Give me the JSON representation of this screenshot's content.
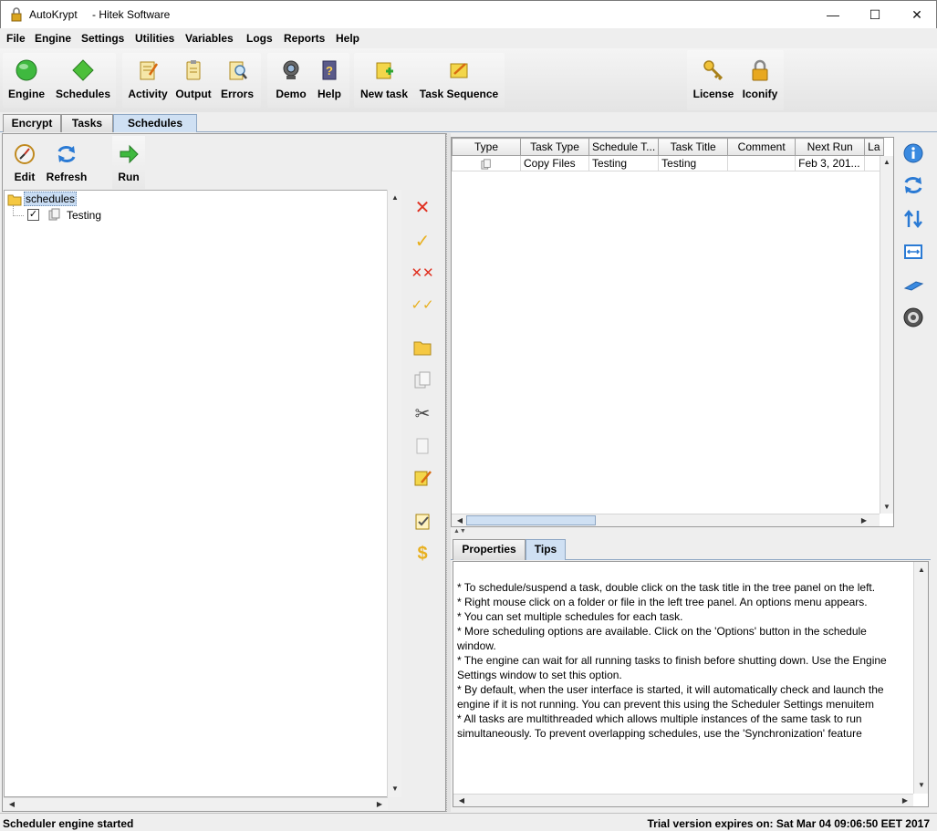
{
  "window": {
    "app_name": "AutoKrypt",
    "subtitle": "- Hitek Software",
    "minimize": "—",
    "maximize": "☐",
    "close": "✕"
  },
  "menu": [
    "File",
    "Engine",
    "Settings",
    "Utilities",
    "Variables",
    "Logs",
    "Reports",
    "Help"
  ],
  "toolbar": {
    "engine": "Engine",
    "schedules": "Schedules",
    "activity": "Activity",
    "output": "Output",
    "errors": "Errors",
    "demo": "Demo",
    "help": "Help",
    "new_task": "New task",
    "task_sequence": "Task Sequence",
    "license": "License",
    "iconify": "Iconify"
  },
  "tabs": [
    "Encrypt",
    "Tasks",
    "Schedules"
  ],
  "active_tab": "Schedules",
  "left": {
    "edit": "Edit",
    "refresh": "Refresh",
    "run": "Run",
    "tree_root": "schedules",
    "tree_item": "Testing",
    "tree_item_checked": true
  },
  "table": {
    "columns": [
      "Type",
      "Task Type",
      "Schedule T...",
      "Task Title",
      "Comment",
      "Next Run",
      "La"
    ],
    "rows": [
      [
        "",
        "Copy Files",
        "Testing",
        "Testing",
        "",
        "Feb 3, 201...",
        ""
      ]
    ]
  },
  "bottom_tabs": [
    "Properties",
    "Tips"
  ],
  "active_bottom_tab": "Tips",
  "tips": [
    "*  To schedule/suspend a task, double click on the task title in the tree panel on the left.",
    "*  Right mouse click on a folder or file in the left tree panel.  An options menu appears.",
    "*  You can set multiple schedules for each task.",
    "*  More scheduling options are available.  Click on the 'Options' button in the schedule",
    "window.",
    "*  The engine can wait for all running tasks to finish before shutting down.  Use the Engine",
    "Settings window to set this option.",
    "*  By default, when the user interface is started, it will automatically check and launch the",
    "engine if it is not running.  You can prevent this using the Scheduler Settings menuitem",
    "*  All tasks are multithreaded which allows multiple instances of the same task to run",
    "simultaneously.  To prevent overlapping schedules, use the 'Synchronization' feature"
  ],
  "status": {
    "left": "Scheduler engine started",
    "right": "Trial version expires on: Sat Mar 04 09:06:50 EET 2017"
  },
  "colors": {
    "accent": "#cfe0f3",
    "delete_red": "#e03020",
    "check_gold": "#e8b020",
    "refresh_blue": "#2a7ad4"
  }
}
